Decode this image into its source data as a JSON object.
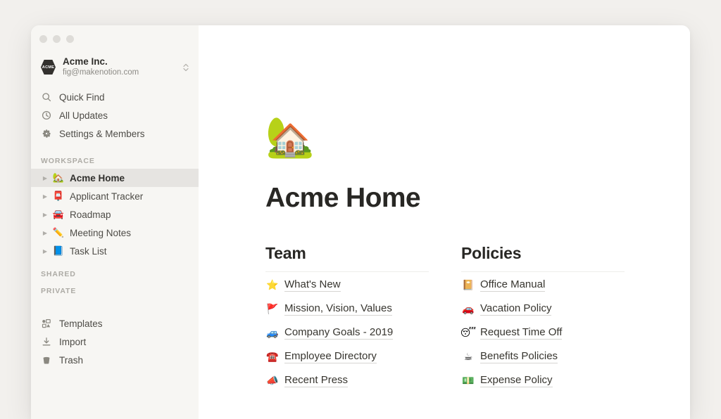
{
  "window": {
    "traffic_lights": [
      "close",
      "minimize",
      "maximize"
    ]
  },
  "sidebar": {
    "workspace": {
      "logo_text": "ACME",
      "name": "Acme Inc.",
      "email": "fig@makenotion.com",
      "switcher_icon": "chevron-up-down-icon"
    },
    "nav": [
      {
        "label": "Quick Find",
        "icon": "search-icon"
      },
      {
        "label": "All Updates",
        "icon": "clock-icon"
      },
      {
        "label": "Settings & Members",
        "icon": "gear-icon"
      }
    ],
    "sections": [
      {
        "label": "WORKSPACE"
      },
      {
        "label": "SHARED"
      },
      {
        "label": "PRIVATE"
      }
    ],
    "workspace_pages": [
      {
        "emoji": "🏡",
        "label": "Acme Home",
        "selected": true
      },
      {
        "emoji": "📮",
        "label": "Applicant Tracker",
        "selected": false
      },
      {
        "emoji": "🚘",
        "label": "Roadmap",
        "selected": false
      },
      {
        "emoji": "✏️",
        "label": "Meeting Notes",
        "selected": false
      },
      {
        "emoji": "📘",
        "label": "Task List",
        "selected": false
      }
    ],
    "bottom_nav": [
      {
        "label": "Templates",
        "icon": "templates-icon"
      },
      {
        "label": "Import",
        "icon": "import-download-icon"
      },
      {
        "label": "Trash",
        "icon": "trash-icon"
      }
    ]
  },
  "main": {
    "page_emoji": "🏡",
    "page_title": "Acme Home",
    "columns": [
      {
        "title": "Team",
        "links": [
          {
            "emoji": "⭐",
            "label": "What's New"
          },
          {
            "emoji": "🚩",
            "label": "Mission, Vision, Values"
          },
          {
            "emoji": "🚙",
            "label": "Company Goals - 2019"
          },
          {
            "emoji": "☎️",
            "label": "Employee Directory"
          },
          {
            "emoji": "📣",
            "label": "Recent Press"
          }
        ]
      },
      {
        "title": "Policies",
        "links": [
          {
            "emoji": "📔",
            "label": "Office Manual"
          },
          {
            "emoji": "🚗",
            "label": "Vacation Policy"
          },
          {
            "emoji": "😴",
            "label": "Request Time Off"
          },
          {
            "emoji": "☕",
            "label": "Benefits Policies"
          },
          {
            "emoji": "💵",
            "label": "Expense Policy"
          }
        ]
      }
    ]
  },
  "colors": {
    "page_background": "#f2f0ed",
    "sidebar_background": "#f7f6f3",
    "selected_row": "#e6e4e1",
    "main_background": "#ffffff",
    "text_primary": "#37352f",
    "text_muted": "#8d8b86"
  }
}
